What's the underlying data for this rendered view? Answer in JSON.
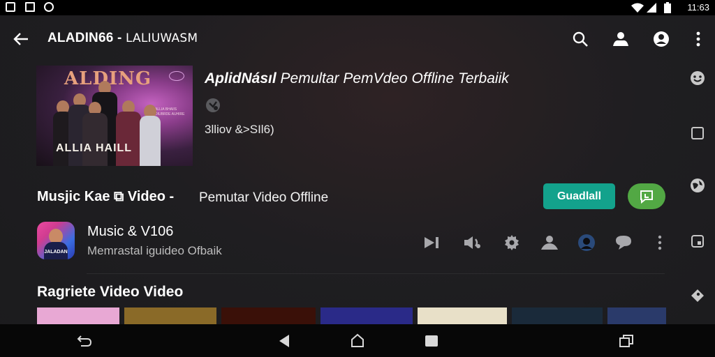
{
  "status_bar": {
    "time": "11:63",
    "icons": [
      "image-icon",
      "n-icon",
      "sync-icon",
      "wifi-icon",
      "signal-icon",
      "battery-icon"
    ]
  },
  "app_bar": {
    "title_main": "ALADIN66 - ",
    "title_sub": "LALIUWASM",
    "actions": [
      "search-icon",
      "group-icon",
      "person-icon",
      "more-vert-icon"
    ]
  },
  "header_card": {
    "thumbnail": {
      "header_text": "ALDING",
      "caption": "ALLIA HAILL",
      "fine_print": "ALLIA BHAIIS DIUBRDE AUHIRE"
    },
    "title_bold": "AplidNásıl",
    "title_rest": " Pemultar PemVdeo Offline Terbaiik",
    "icon": "badge-icon",
    "meta": "3lliov &>SIl6)"
  },
  "section": {
    "title": "Musjic Kae ⧉ Video -",
    "subtitle": "Pemutar Video Offline",
    "download_label": "Guadlall",
    "share_icon": "message-icon"
  },
  "app_row": {
    "icon_text": "JALADAN",
    "name": "Music & V106",
    "description": "Memrastal iguideo Ofbaik",
    "actions": [
      "skip-next-icon",
      "volume-icon",
      "settings-icon",
      "person-icon",
      "avatar",
      "comment-icon",
      "more-vert-icon"
    ]
  },
  "rail": {
    "title": "Ragriete Video Video",
    "tile_colors": [
      "#e8a8d4",
      "#8a6a28",
      "#3a1008",
      "#2a2a88",
      "#e8e0c8",
      "#1a2a3a",
      "#2a3a6a"
    ]
  },
  "right_rail": {
    "icons": [
      "emoji-icon",
      "square-icon",
      "globe-icon",
      "crop-icon",
      "label-icon"
    ]
  },
  "nav_bar": {
    "buttons": [
      "undo-icon",
      "back-triangle-icon",
      "home-icon",
      "recents-icon",
      "switch-icon"
    ]
  },
  "colors": {
    "download": "#13a28c",
    "share": "#52a844",
    "background": "#1d1d1f",
    "status_bar": "#000000",
    "nav_bar": "#070707"
  }
}
